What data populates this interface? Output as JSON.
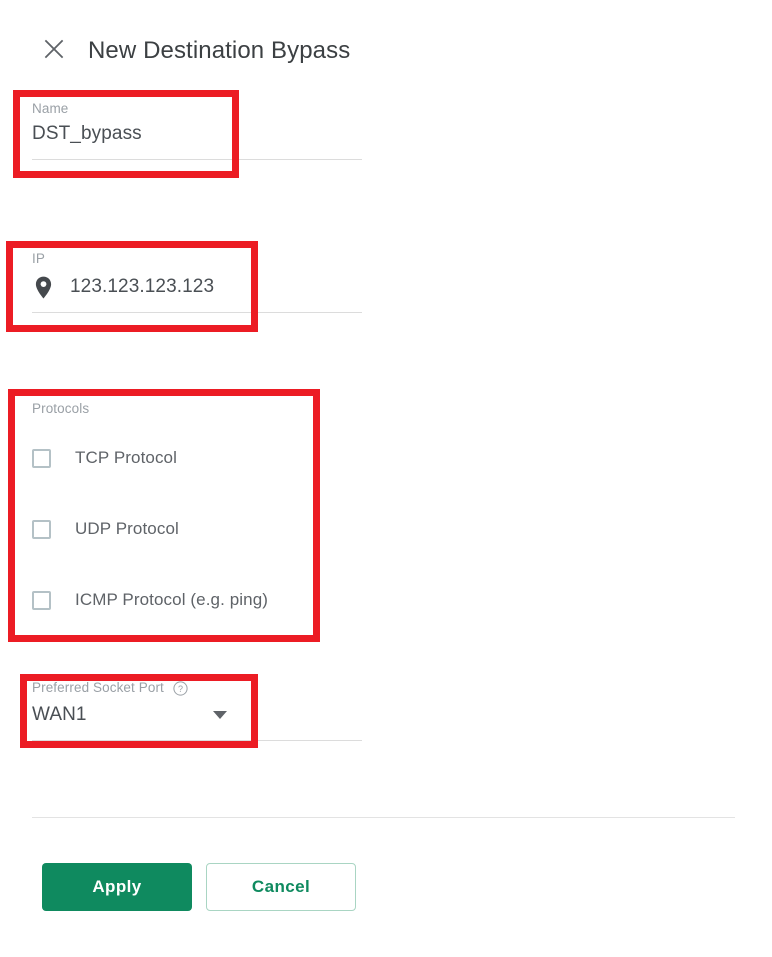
{
  "dialog": {
    "title": "New Destination Bypass",
    "close_icon": "close-icon"
  },
  "fields": {
    "name": {
      "label": "Name",
      "value": "DST_bypass",
      "placeholder": "Name"
    },
    "ip": {
      "label": "IP",
      "value": "123.123.123.123",
      "placeholder": "IP",
      "icon": "location-pin-icon"
    },
    "protocols": {
      "label": "Protocols",
      "items": [
        {
          "label": "TCP Protocol",
          "checked": false
        },
        {
          "label": "UDP Protocol",
          "checked": false
        },
        {
          "label": "ICMP Protocol (e.g. ping)",
          "checked": false
        }
      ]
    },
    "socket_port": {
      "label": "Preferred Socket Port",
      "help_icon": "help-circle-icon",
      "selected": "WAN1",
      "caret_icon": "chevron-down-icon"
    }
  },
  "actions": {
    "apply_label": "Apply",
    "cancel_label": "Cancel"
  },
  "colors": {
    "accent_green": "#0f8a5f",
    "annotation_red": "#ec1c24",
    "label_grey": "#9aa0a6",
    "value_grey": "#4a4f54",
    "checkbox_border": "#b4c1c6"
  }
}
